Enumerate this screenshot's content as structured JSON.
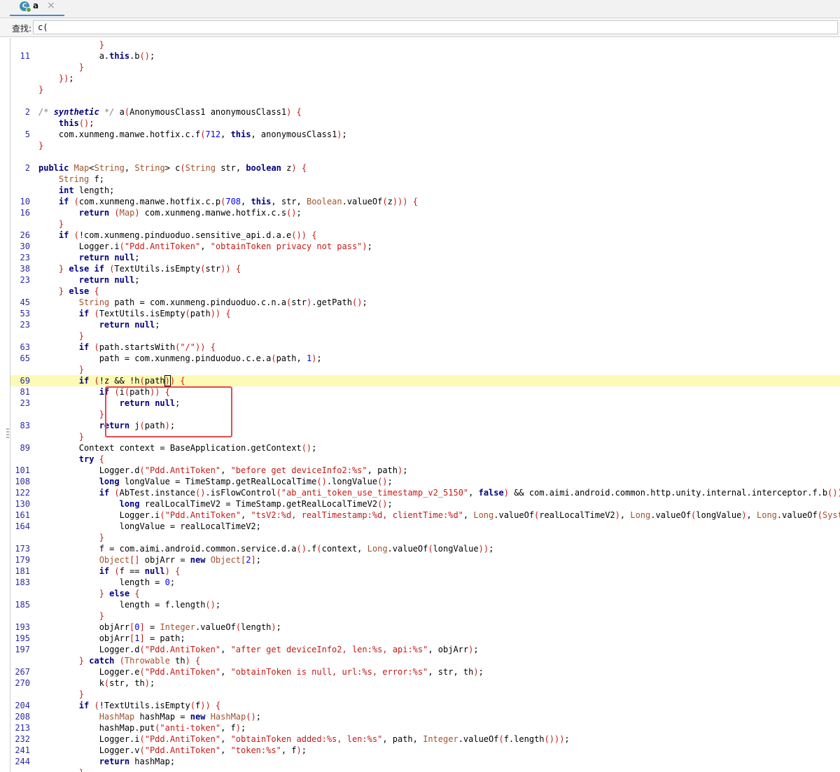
{
  "tab": {
    "icon_letter": "C",
    "label": "a",
    "close": "×"
  },
  "search": {
    "label": "查找:",
    "value": "c("
  },
  "code_lines": [
    {
      "n": "",
      "t": "            <span class='pn'>}</span>"
    },
    {
      "n": "11",
      "t": "            a.<span class='kw'>this</span>.b<span class='pn'>()</span>;"
    },
    {
      "n": "",
      "t": "        <span class='pn'>}</span>"
    },
    {
      "n": "",
      "t": "    <span class='pn'>})</span>;"
    },
    {
      "n": "",
      "t": "<span class='pn'>}</span>"
    },
    {
      "n": "",
      "t": ""
    },
    {
      "n": "2",
      "t": "<span class='cm'>/* </span><span class='cmk'>synthetic</span><span class='cm'> */</span> a<span class='pn'>(</span>AnonymousClass1 anonymousClass1<span class='pn'>)</span> <span class='pn'>{</span>"
    },
    {
      "n": "",
      "t": "    <span class='kw'>this</span><span class='pn'>()</span>;"
    },
    {
      "n": "5",
      "t": "    com.xunmeng.manwe.hotfix.c.f<span class='pn'>(</span><span class='nm'>712</span>, <span class='kw'>this</span>, anonymousClass1<span class='pn'>)</span>;"
    },
    {
      "n": "",
      "t": "<span class='pn'>}</span>"
    },
    {
      "n": "",
      "t": ""
    },
    {
      "n": "2",
      "t": "<span class='kw'>public</span> <span class='ty'>Map</span>&lt;<span class='ty'>String</span>, <span class='ty'>String</span>&gt; c<span class='pn'>(</span><span class='ty'>String</span> str, <span class='kw'>boolean</span> z<span class='pn'>)</span> <span class='pn'>{</span>"
    },
    {
      "n": "",
      "t": "    <span class='ty'>String</span> f;"
    },
    {
      "n": "",
      "t": "    <span class='kw'>int</span> length;"
    },
    {
      "n": "10",
      "t": "    <span class='kw'>if</span> <span class='pn'>(</span>com.xunmeng.manwe.hotfix.c.p<span class='pn'>(</span><span class='nm'>708</span>, <span class='kw'>this</span>, str, <span class='ty'>Boolean</span>.valueOf<span class='pn'>(</span>z<span class='pn'>)))</span> <span class='pn'>{</span>"
    },
    {
      "n": "16",
      "t": "        <span class='kw'>return</span> <span class='pn'>(</span><span class='ty'>Map</span><span class='pn'>)</span> com.xunmeng.manwe.hotfix.c.s<span class='pn'>()</span>;"
    },
    {
      "n": "",
      "t": "    <span class='pn'>}</span>"
    },
    {
      "n": "26",
      "t": "    <span class='kw'>if</span> <span class='pn'>(</span>!com.xunmeng.pinduoduo.sensitive_api.d.a.e<span class='pn'>())</span> <span class='pn'>{</span>"
    },
    {
      "n": "30",
      "t": "        Logger.i<span class='pn'>(</span><span class='st'>\"Pdd.AntiToken\"</span>, <span class='st'>\"obtainToken privacy not pass\"</span><span class='pn'>)</span>;"
    },
    {
      "n": "23",
      "t": "        <span class='kw'>return</span> <span class='kw'>null</span>;"
    },
    {
      "n": "38",
      "t": "    <span class='pn'>}</span> <span class='kw'>else if</span> <span class='pn'>(</span>TextUtils.isEmpty<span class='pn'>(</span>str<span class='pn'>))</span> <span class='pn'>{</span>"
    },
    {
      "n": "23",
      "t": "        <span class='kw'>return</span> <span class='kw'>null</span>;"
    },
    {
      "n": "",
      "t": "    <span class='pn'>}</span> <span class='kw'>else</span> <span class='pn'>{</span>"
    },
    {
      "n": "45",
      "t": "        <span class='ty'>String</span> path = com.xunmeng.pinduoduo.c.n.a<span class='pn'>(</span>str<span class='pn'>)</span>.getPath<span class='pn'>()</span>;"
    },
    {
      "n": "53",
      "t": "        <span class='kw'>if</span> <span class='pn'>(</span>TextUtils.isEmpty<span class='pn'>(</span>path<span class='pn'>))</span> <span class='pn'>{</span>"
    },
    {
      "n": "23",
      "t": "            <span class='kw'>return</span> <span class='kw'>null</span>;"
    },
    {
      "n": "",
      "t": "        <span class='pn'>}</span>"
    },
    {
      "n": "63",
      "t": "        <span class='kw'>if</span> <span class='pn'>(</span>path.startsWith<span class='pn'>(</span><span class='st'>\"/\"</span><span class='pn'>))</span> <span class='pn'>{</span>"
    },
    {
      "n": "65",
      "t": "            path = com.xunmeng.pinduoduo.c.e.a<span class='pn'>(</span>path, <span class='nm'>1</span><span class='pn'>)</span>;"
    },
    {
      "n": "",
      "t": "        <span class='pn'>}</span>"
    },
    {
      "n": "69",
      "t": "        <span class='kw'>if</span> <span class='pn'>(</span>!z &amp;&amp; !h<span class='pn'>(</span>path<span class='pn caret'>)</span><span class='pn'>)</span> <span class='pn'>{</span>",
      "hl": true
    },
    {
      "n": "81",
      "t": "            <span class='kw'>if</span> <span class='pn'>(</span>i<span class='pn'>(</span>path<span class='pn'>))</span> <span class='pn'>{</span>"
    },
    {
      "n": "23",
      "t": "                <span class='kw'>return</span> <span class='kw'>null</span>;"
    },
    {
      "n": "",
      "t": "            <span class='pn'>}</span>"
    },
    {
      "n": "83",
      "t": "            <span class='kw'>return</span> j<span class='pn'>(</span>path<span class='pn'>)</span>;"
    },
    {
      "n": "",
      "t": "        <span class='pn'>}</span>"
    },
    {
      "n": "89",
      "t": "        Context context = BaseApplication.getContext<span class='pn'>()</span>;"
    },
    {
      "n": "",
      "t": "        <span class='kw'>try</span> <span class='pn'>{</span>"
    },
    {
      "n": "101",
      "t": "            Logger.d<span class='pn'>(</span><span class='st'>\"Pdd.AntiToken\"</span>, <span class='st'>\"before get deviceInfo2:%s\"</span>, path<span class='pn'>)</span>;"
    },
    {
      "n": "108",
      "t": "            <span class='kw'>long</span> longValue = TimeStamp.getRealLocalTime<span class='pn'>()</span>.longValue<span class='pn'>()</span>;"
    },
    {
      "n": "122",
      "t": "            <span class='kw'>if</span> <span class='pn'>(</span>AbTest.instance<span class='pn'>()</span>.isFlowControl<span class='pn'>(</span><span class='st'>\"ab_anti_token_use_timestamp_v2_5150\"</span>, <span class='kw'>false</span><span class='pn'>)</span> &amp;&amp; com.aimi.android.common.http.unity.internal.interceptor.f.b<span class='pn'>())</span> <span class='pn'>{</span>"
    },
    {
      "n": "130",
      "t": "                <span class='kw'>long</span> realLocalTimeV2 = TimeStamp.getRealLocalTimeV2<span class='pn'>()</span>;"
    },
    {
      "n": "161",
      "t": "                Logger.i<span class='pn'>(</span><span class='st'>\"Pdd.AntiToken\"</span>, <span class='st'>\"tsV2:%d, realTimestamp:%d, clientTime:%d\"</span>, <span class='ty'>Long</span>.valueOf<span class='pn'>(</span>realLocalTimeV2<span class='pn'>)</span>, <span class='ty'>Long</span>.valueOf<span class='pn'>(</span>longValue<span class='pn'>)</span>, <span class='ty'>Long</span>.valueOf<span class='pn'>(</span><span class='ty'>System</span>.currentTimeMillis<span class='pn'>()))</span>;"
    },
    {
      "n": "164",
      "t": "                longValue = realLocalTimeV2;"
    },
    {
      "n": "",
      "t": "            <span class='pn'>}</span>"
    },
    {
      "n": "173",
      "t": "            f = com.aimi.android.common.service.d.a<span class='pn'>()</span>.f<span class='pn'>(</span>context, <span class='ty'>Long</span>.valueOf<span class='pn'>(</span>longValue<span class='pn'>))</span>;"
    },
    {
      "n": "179",
      "t": "            <span class='ty'>Object</span><span class='pn'>[]</span> objArr = <span class='kw'>new</span> <span class='ty'>Object</span><span class='pn'>[</span><span class='nm'>2</span><span class='pn'>]</span>;"
    },
    {
      "n": "181",
      "t": "            <span class='kw'>if</span> <span class='pn'>(</span>f == <span class='kw'>null</span><span class='pn'>)</span> <span class='pn'>{</span>"
    },
    {
      "n": "183",
      "t": "                length = <span class='nm'>0</span>;"
    },
    {
      "n": "",
      "t": "            <span class='pn'>}</span> <span class='kw'>else</span> <span class='pn'>{</span>"
    },
    {
      "n": "185",
      "t": "                length = f.length<span class='pn'>()</span>;"
    },
    {
      "n": "",
      "t": "            <span class='pn'>}</span>"
    },
    {
      "n": "193",
      "t": "            objArr<span class='pn'>[</span><span class='nm'>0</span><span class='pn'>]</span> = <span class='ty'>Integer</span>.valueOf<span class='pn'>(</span>length<span class='pn'>)</span>;"
    },
    {
      "n": "195",
      "t": "            objArr<span class='pn'>[</span><span class='nm'>1</span><span class='pn'>]</span> = path;"
    },
    {
      "n": "197",
      "t": "            Logger.d<span class='pn'>(</span><span class='st'>\"Pdd.AntiToken\"</span>, <span class='st'>\"after get deviceInfo2, len:%s, api:%s\"</span>, objArr<span class='pn'>)</span>;"
    },
    {
      "n": "",
      "t": "        <span class='pn'>}</span> <span class='kw'>catch</span> <span class='pn'>(</span><span class='ty'>Throwable</span> th<span class='pn'>)</span> <span class='pn'>{</span>"
    },
    {
      "n": "267",
      "t": "            Logger.e<span class='pn'>(</span><span class='st'>\"Pdd.AntiToken\"</span>, <span class='st'>\"obtainToken is null, url:%s, error:%s\"</span>, str, th<span class='pn'>)</span>;"
    },
    {
      "n": "270",
      "t": "            k<span class='pn'>(</span>str, th<span class='pn'>)</span>;"
    },
    {
      "n": "",
      "t": "        <span class='pn'>}</span>"
    },
    {
      "n": "204",
      "t": "        <span class='kw'>if</span> <span class='pn'>(</span>!TextUtils.isEmpty<span class='pn'>(</span>f<span class='pn'>))</span> <span class='pn'>{</span>"
    },
    {
      "n": "208",
      "t": "            <span class='ty'>HashMap</span> hashMap = <span class='kw'>new</span> <span class='ty'>HashMap</span><span class='pn'>()</span>;"
    },
    {
      "n": "213",
      "t": "            hashMap.put<span class='pn'>(</span><span class='st'>\"anti-token\"</span>, f<span class='pn'>)</span>;"
    },
    {
      "n": "232",
      "t": "            Logger.i<span class='pn'>(</span><span class='st'>\"Pdd.AntiToken\"</span>, <span class='st'>\"obtainToken added:%s, len:%s\"</span>, path, <span class='ty'>Integer</span>.valueOf<span class='pn'>(</span>f.length<span class='pn'>()))</span>;"
    },
    {
      "n": "241",
      "t": "            Logger.v<span class='pn'>(</span><span class='st'>\"Pdd.AntiToken\"</span>, <span class='st'>\"token:%s\"</span>, f<span class='pn'>)</span>;"
    },
    {
      "n": "244",
      "t": "            <span class='kw'>return</span> hashMap;"
    },
    {
      "n": "",
      "t": "        <span class='pn'>}</span>"
    }
  ]
}
